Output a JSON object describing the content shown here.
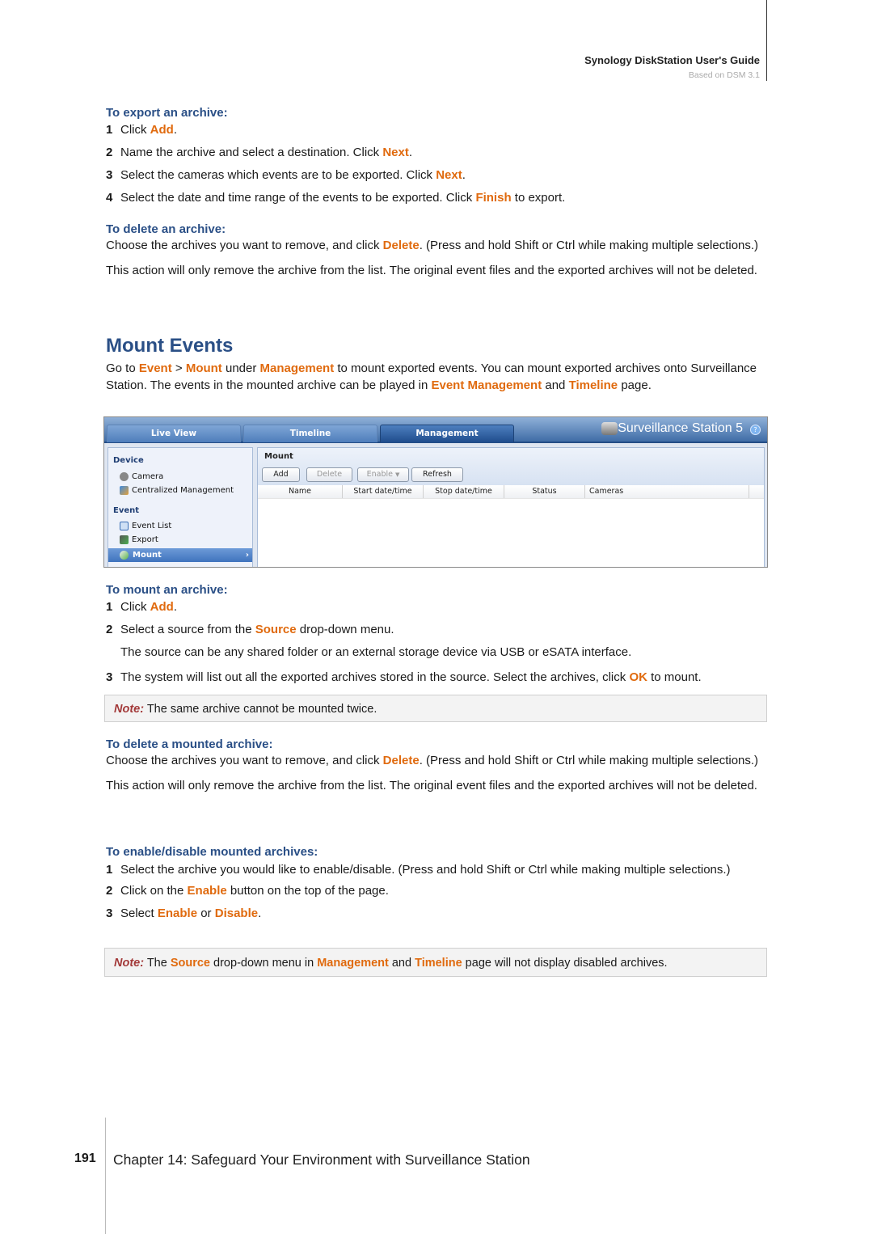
{
  "header": {
    "title": "Synology DiskStation User's Guide",
    "subtitle": "Based on DSM 3.1"
  },
  "export_archive": {
    "heading": "To export an archive:",
    "steps": [
      {
        "n": "1",
        "pre": "Click ",
        "hl": "Add",
        "post": "."
      },
      {
        "n": "2",
        "pre": "Name the archive and select a destination. Click ",
        "hl": "Next",
        "post": "."
      },
      {
        "n": "3",
        "pre": "Select the cameras which events are to be exported. Click ",
        "hl": "Next",
        "post": "."
      },
      {
        "n": "4",
        "pre": "Select the date and time range of the events to be exported. Click ",
        "hl": "Finish",
        "post": " to export."
      }
    ]
  },
  "delete_archive": {
    "heading": "To delete an archive:",
    "p1_pre": "Choose the archives you want to remove, and click ",
    "p1_hl": "Delete",
    "p1_post": ". (Press and hold Shift or Ctrl while making multiple selections.)",
    "p2": "This action will only remove the archive from the list. The original event files and the exported archives will not be deleted."
  },
  "mount_events": {
    "title": "Mount Events",
    "intro": {
      "t1": "Go to ",
      "h1": "Event",
      "t2": " > ",
      "h2": "Mount",
      "t3": " under ",
      "h3": "Management",
      "t4": " to mount exported events. You can mount exported archives onto Surveillance Station. The events in the mounted archive can be played in ",
      "h4": "Event Management",
      "t5": " and ",
      "h5": "Timeline",
      "t6": " page."
    }
  },
  "screenshot": {
    "tabs": [
      "Live View",
      "Timeline",
      "Management"
    ],
    "active_tab": "Management",
    "brand": "Surveillance Station 5",
    "help": "?",
    "sidebar": {
      "sections": [
        {
          "title": "Device",
          "items": [
            "Camera",
            "Centralized Management"
          ]
        },
        {
          "title": "Event",
          "items": [
            "Event List",
            "Export",
            "Mount"
          ]
        }
      ],
      "selected": "Mount"
    },
    "panel_title": "Mount",
    "buttons": {
      "add": "Add",
      "delete": "Delete",
      "enable": "Enable",
      "refresh": "Refresh"
    },
    "columns": [
      "Name",
      "Start date/time",
      "Stop date/time",
      "Status",
      "Cameras"
    ]
  },
  "mount_archive": {
    "heading": "To mount an archive:",
    "s1_pre": "Click ",
    "s1_hl": "Add",
    "s1_post": ".",
    "s2_pre": "Select a source from the ",
    "s2_hl": "Source",
    "s2_post": " drop-down menu.",
    "s2_detail": "The source can be any shared folder or an external storage device via USB or eSATA interface.",
    "s3_pre": "The system will list out all the exported archives stored in the source. Select the archives, click ",
    "s3_hl": "OK",
    "s3_post": " to mount.",
    "note_label": "Note:",
    "note_text": " The same archive cannot be mounted twice."
  },
  "delete_mounted": {
    "heading": "To delete a mounted archive:",
    "p1_pre": "Choose the archives you want to remove, and click ",
    "p1_hl": "Delete",
    "p1_post": ". (Press and hold Shift or Ctrl while making multiple selections.)",
    "p2": "This action will only remove the archive from the list. The original event files and the exported archives will not be deleted."
  },
  "enable_disable": {
    "heading": "To enable/disable mounted archives:",
    "s1": "Select the archive you would like to enable/disable. (Press and hold Shift or Ctrl while making multiple selections.)",
    "s2_pre": "Click on the ",
    "s2_hl": "Enable",
    "s2_post": " button on the top of the page.",
    "s3_pre": "Select ",
    "s3_hl1": "Enable",
    "s3_mid": " or ",
    "s3_hl2": "Disable",
    "s3_post": ".",
    "note_label": "Note:",
    "note_t1": " The ",
    "note_h1": "Source",
    "note_t2": " drop-down menu in ",
    "note_h2": "Management",
    "note_t3": " and ",
    "note_h3": "Timeline",
    "note_t4": " page will not display disabled archives."
  },
  "footer": {
    "page_number": "191",
    "chapter": "Chapter 14: Safeguard Your Environment with Surveillance Station"
  },
  "colors": {
    "heading_blue": "#2a4f86",
    "highlight_orange": "#e06a0e",
    "note_red": "#a33a3a"
  }
}
